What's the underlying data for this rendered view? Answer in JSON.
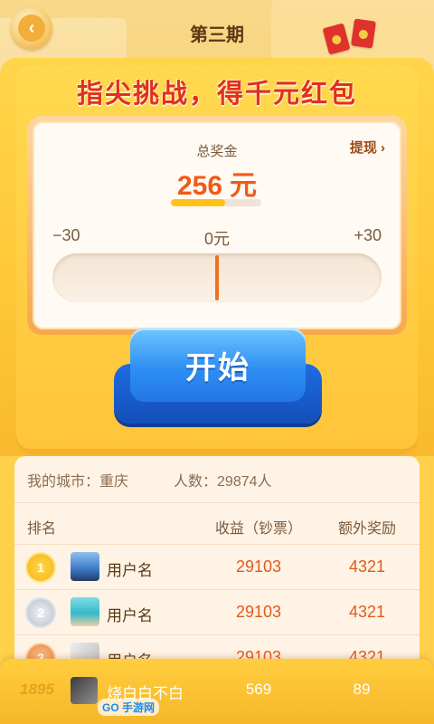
{
  "header": {
    "title": "第三期",
    "back_icon": "chevron-left-icon"
  },
  "machine": {
    "slogan": "指尖挑战，得千元红包",
    "prize_label": "总奖金",
    "withdraw_label": "提现 ›",
    "prize_amount": "256",
    "prize_unit": "元",
    "prize_progress": 0.6,
    "scale_min": "−30",
    "scale_mid": "0元",
    "scale_max": "+30",
    "start_label": "开始"
  },
  "panel": {
    "city_label": "我的城市：重庆",
    "count_label": "人数：29874人",
    "columns": {
      "rank": "排名",
      "earnings": "收益（钞票）",
      "bonus": "额外奖励"
    },
    "rows": [
      {
        "rank": "1",
        "medal": "gold",
        "name": "用户名",
        "earnings": "29103",
        "bonus": "4321",
        "avatar_color": "#3a78c2"
      },
      {
        "rank": "2",
        "medal": "silver",
        "name": "用户名",
        "earnings": "29103",
        "bonus": "4321",
        "avatar_color": "#36b8c9"
      },
      {
        "rank": "3",
        "medal": "bronze",
        "name": "用户名",
        "earnings": "29103",
        "bonus": "4321",
        "avatar_color": "#c9c9c9"
      }
    ]
  },
  "my_row": {
    "rank": "1895",
    "name": "烧白白不白",
    "earnings": "569",
    "bonus": "89"
  },
  "watermark": "GO 手游网",
  "colors": {
    "accent_orange": "#f05a16",
    "button_blue": "#2f8ff2",
    "machine_yellow": "#ffc83a"
  }
}
